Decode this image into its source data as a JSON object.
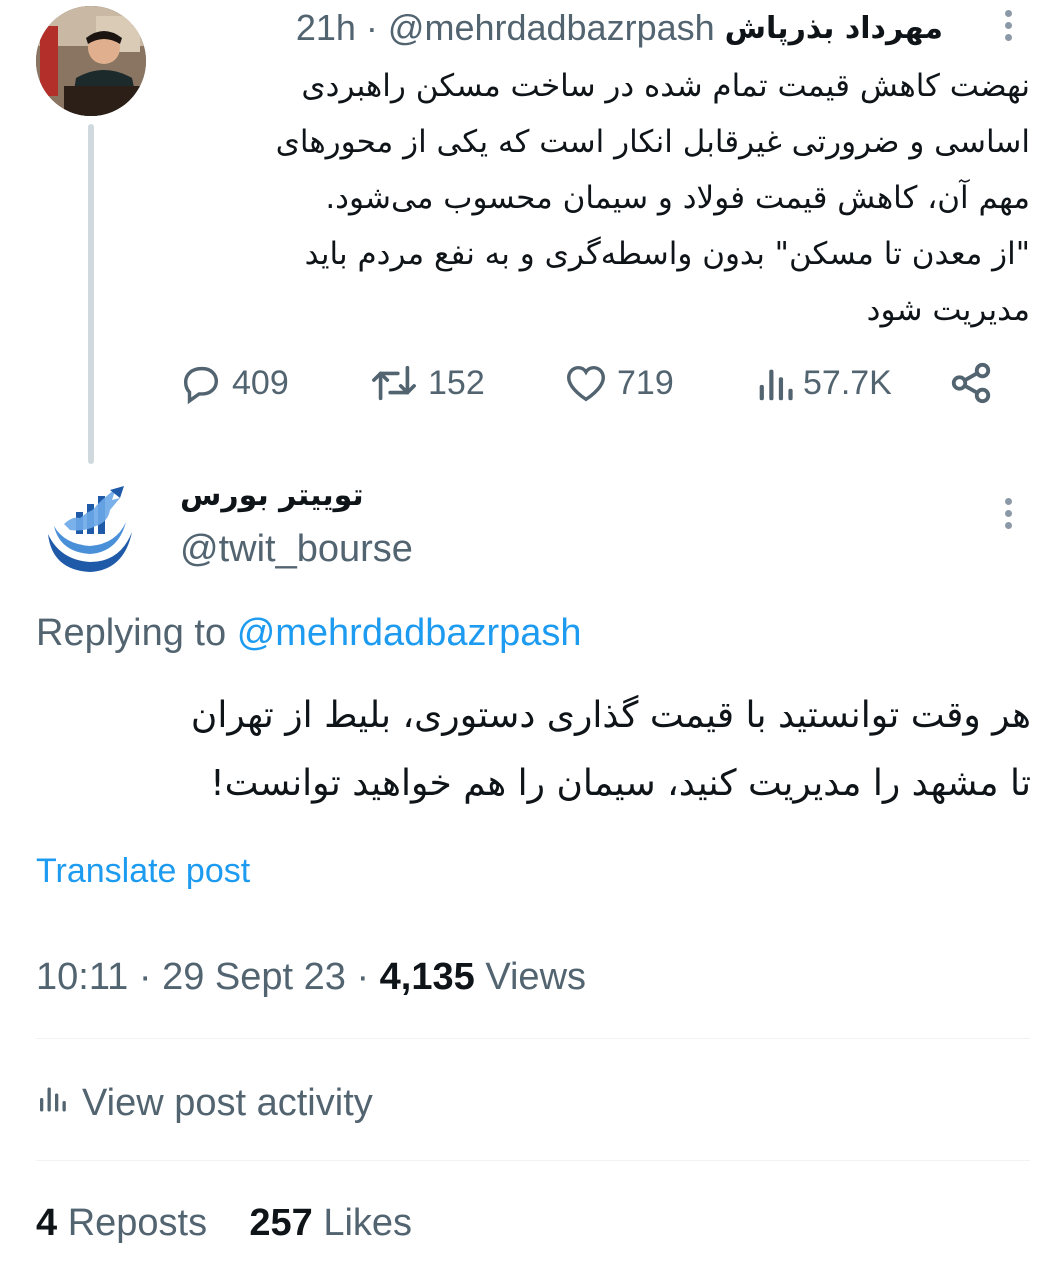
{
  "parent_post": {
    "author_name": "مهرداد بذرپاش",
    "handle": "@mehrdadbazrpash",
    "separator": "·",
    "time_ago": "21h",
    "text": "نهضت کاهش قیمت تمام شده در ساخت مسکن راهبردی\nاساسی و ضرورتی غیرقابل انکار است که یکی از محورهای\nمهم آن، کاهش قیمت فولاد و سیمان محسوب می‌شود.\n\"از معدن تا مسکن\" بدون واسطه‌گری و به نفع مردم باید\nمدیریت شود",
    "actions": {
      "replies": "409",
      "reposts": "152",
      "likes": "719",
      "views": "57.7K"
    },
    "icons": [
      "reply-icon",
      "repost-icon",
      "like-icon",
      "views-icon",
      "share-icon",
      "more-icon"
    ]
  },
  "reply_post": {
    "author_name": "توییتر بورس",
    "handle": "@twit_bourse",
    "replying_prefix": "Replying to",
    "replying_handle": "@mehrdadbazrpash",
    "text": "هر وقت توانستید با قیمت گذاری دستوری، بلیط از تهران\nتا مشهد را مدیریت کنید، سیمان را هم خواهید توانست!",
    "translate_label": "Translate post",
    "time": "10:11",
    "date": "29 Sept 23",
    "views_count": "4,135",
    "views_label": "Views",
    "dot": "·",
    "activity_label": "View post activity",
    "reposts_count": "4",
    "reposts_label": "Reposts",
    "likes_count": "257",
    "likes_label": "Likes"
  },
  "colors": {
    "text_primary": "#0f1419",
    "text_secondary": "#536471",
    "accent": "#1d9bf0",
    "divider": "#eff3f4"
  }
}
